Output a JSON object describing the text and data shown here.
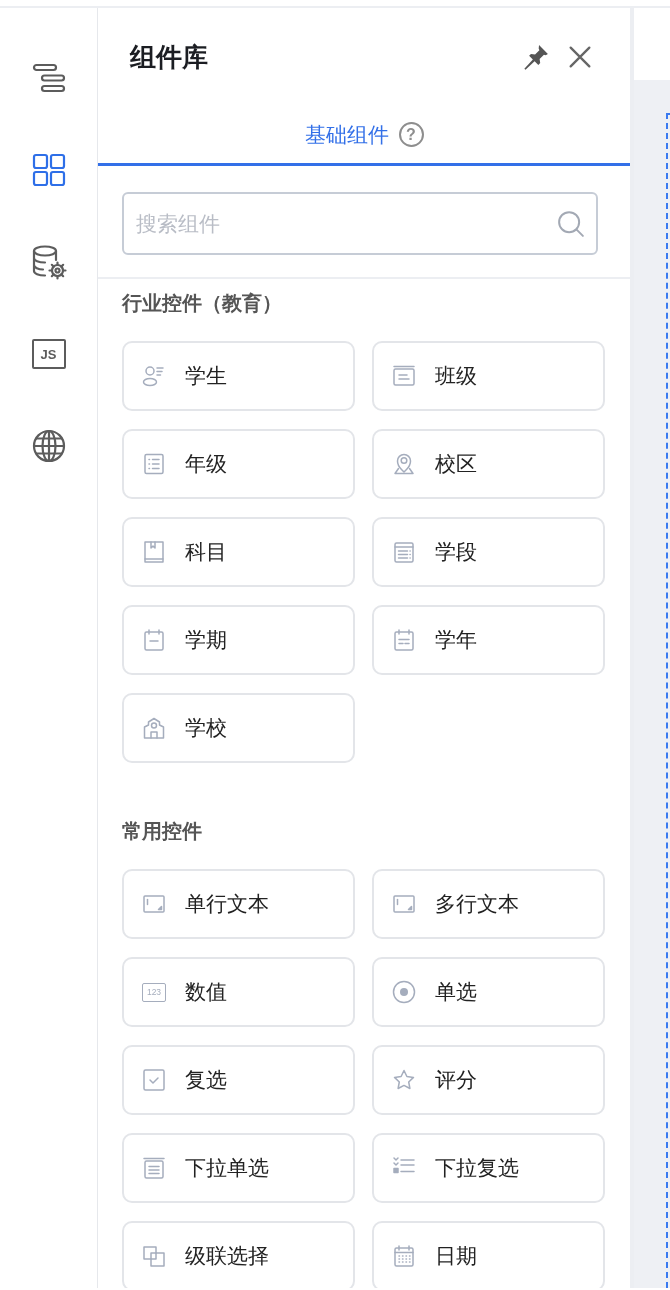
{
  "sidebar": {
    "items": [
      {
        "kind": "outline",
        "selected": false
      },
      {
        "kind": "components",
        "selected": true
      },
      {
        "kind": "data",
        "selected": false
      },
      {
        "kind": "script",
        "label": "JS",
        "selected": false
      },
      {
        "kind": "globe",
        "selected": false
      }
    ]
  },
  "panel": {
    "title": "组件库",
    "tabs": [
      {
        "label": "基础组件",
        "help": "?",
        "selected": true
      }
    ],
    "search": {
      "placeholder": "搜索组件"
    },
    "sections": [
      {
        "title": "行业控件（教育）",
        "items": [
          {
            "label": "学生",
            "kind": "student"
          },
          {
            "label": "班级",
            "kind": "class"
          },
          {
            "label": "年级",
            "kind": "grade"
          },
          {
            "label": "校区",
            "kind": "campus"
          },
          {
            "label": "科目",
            "kind": "subject"
          },
          {
            "label": "学段",
            "kind": "stage"
          },
          {
            "label": "学期",
            "kind": "term"
          },
          {
            "label": "学年",
            "kind": "year"
          },
          {
            "label": "学校",
            "kind": "school"
          }
        ]
      },
      {
        "title": "常用控件",
        "items": [
          {
            "label": "单行文本",
            "kind": "input"
          },
          {
            "label": "多行文本",
            "kind": "textarea"
          },
          {
            "label": "数值",
            "kind": "number",
            "icon_text": "123"
          },
          {
            "label": "单选",
            "kind": "radio"
          },
          {
            "label": "复选",
            "kind": "checkbox"
          },
          {
            "label": "评分",
            "kind": "star"
          },
          {
            "label": "下拉单选",
            "kind": "select"
          },
          {
            "label": "下拉复选",
            "kind": "multiselect"
          },
          {
            "label": "级联选择",
            "kind": "cascade"
          },
          {
            "label": "日期",
            "kind": "date"
          }
        ]
      }
    ]
  }
}
